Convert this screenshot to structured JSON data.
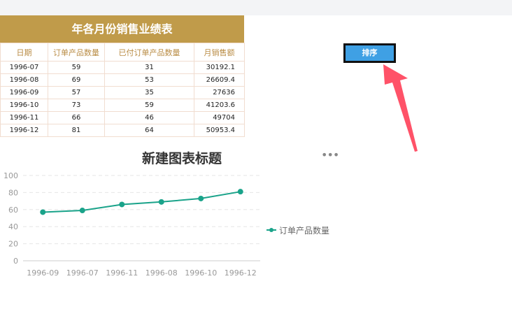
{
  "report": {
    "title": "年各月份销售业绩表",
    "columns": [
      "日期",
      "订单产品数量",
      "已付订单产品数量",
      "月销售额"
    ],
    "rows": [
      [
        "1996-07",
        "59",
        "31",
        "30192.1"
      ],
      [
        "1996-08",
        "69",
        "53",
        "26609.4"
      ],
      [
        "1996-09",
        "57",
        "35",
        "27636"
      ],
      [
        "1996-10",
        "73",
        "59",
        "41203.6"
      ],
      [
        "1996-11",
        "66",
        "46",
        "49704"
      ],
      [
        "1996-12",
        "81",
        "64",
        "50953.4"
      ]
    ]
  },
  "sort_button": {
    "label": "排序"
  },
  "colors": {
    "header_bg": "#c09b4a",
    "header_text": "#b98c45",
    "button_bg": "#3fa0e4",
    "series": "#1aa38a",
    "arrow": "#ff5268"
  },
  "icons": {
    "more": "more-horizontal-icon",
    "annotation": "red-arrow-icon"
  },
  "chart_data": {
    "type": "line",
    "title": "新建图表标题",
    "categories": [
      "1996-09",
      "1996-07",
      "1996-11",
      "1996-08",
      "1996-10",
      "1996-12"
    ],
    "series": [
      {
        "name": "订单产品数量",
        "values": [
          57,
          59,
          66,
          69,
          73,
          81
        ]
      }
    ],
    "yticks": [
      0,
      20,
      40,
      60,
      80,
      100
    ],
    "ylim": [
      0,
      100
    ],
    "grid": true,
    "legend": "right"
  }
}
